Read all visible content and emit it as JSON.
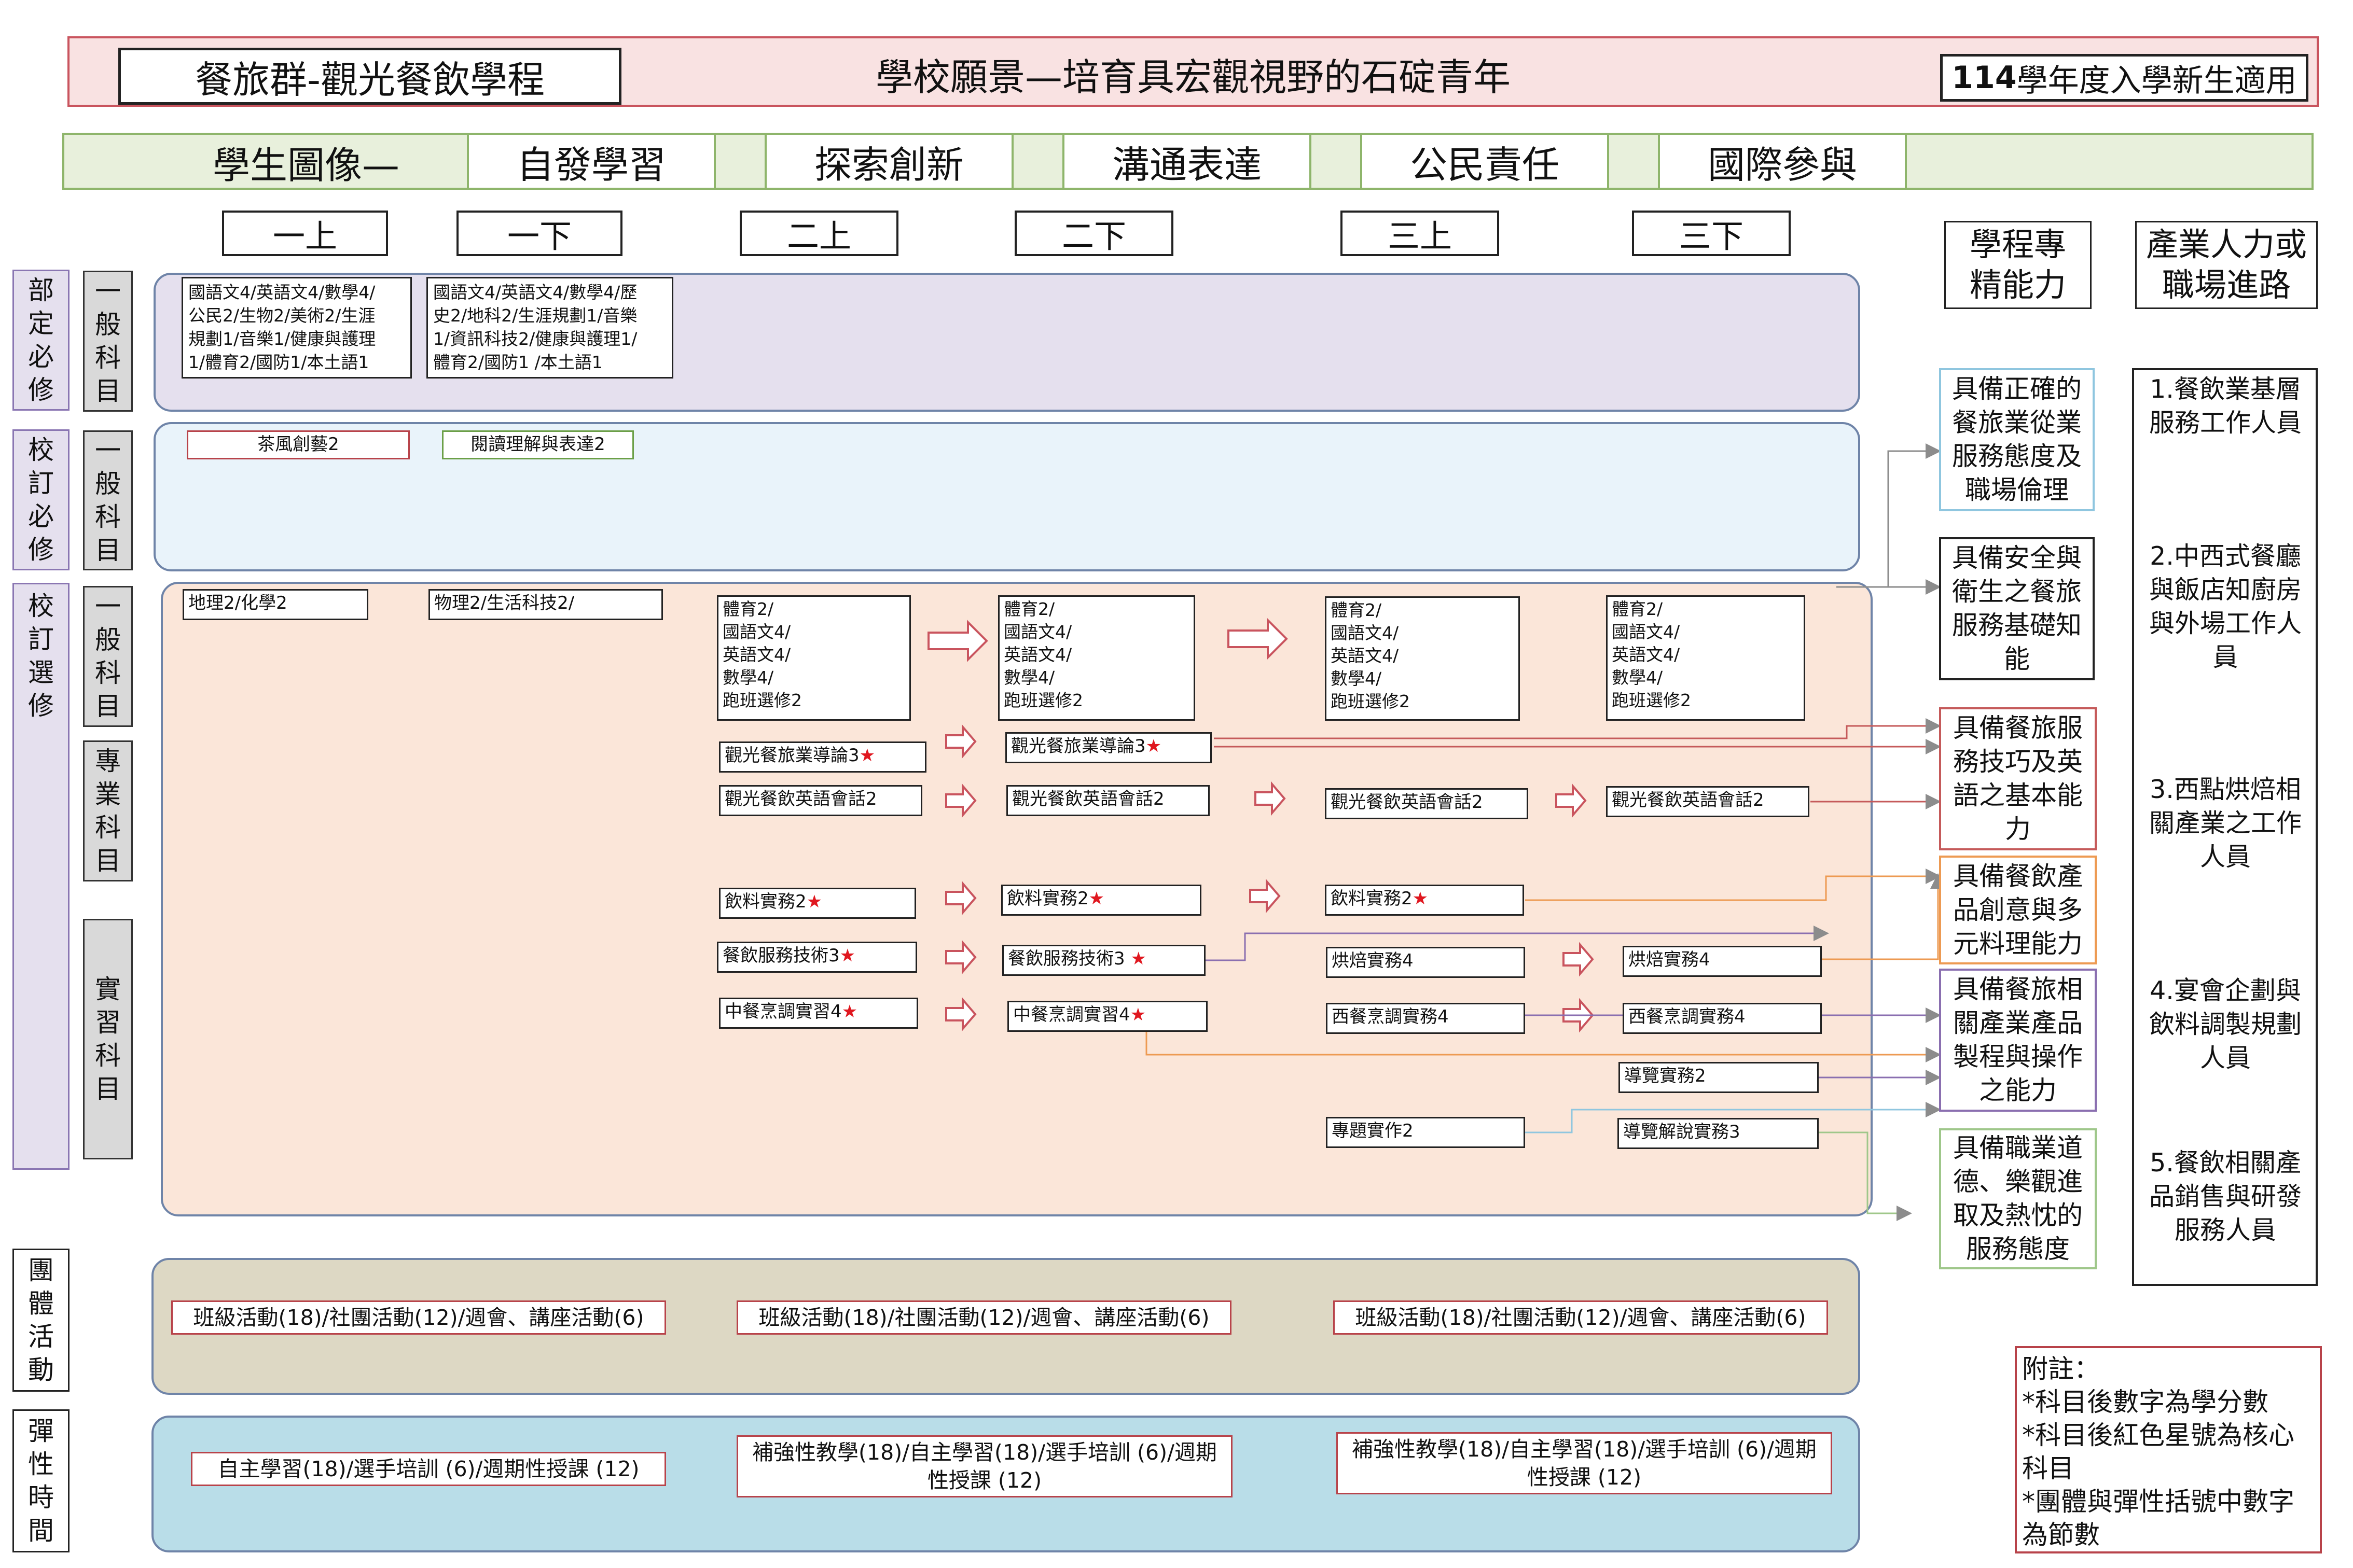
{
  "header": {
    "program": "餐旅群-觀光餐飲學程",
    "vision": "學校願景—培育具宏觀視野的石碇青年",
    "year_num": "114",
    "year_rest": "學年度入學新生適用"
  },
  "portrait": {
    "label": "學生圖像—",
    "items": [
      "自發學習",
      "探索創新",
      "溝通表達",
      "公民責任",
      "國際參與"
    ]
  },
  "semesters": [
    "一上",
    "一下",
    "二上",
    "二下",
    "三上",
    "三下"
  ],
  "right_headers": {
    "abilities": "學程專精能力",
    "careers": "產業人力或職場進路"
  },
  "categories": {
    "required": "部定必修",
    "school_required": "校訂必修",
    "school_elective": "校訂選修",
    "group_activity": "團體活動",
    "flex_time": "彈性時間"
  },
  "subcategories": {
    "general1": "一般科目",
    "general2": "一般科目",
    "general3": "一般科目",
    "professional": "專業科目",
    "practical": "實習科目"
  },
  "required_general": {
    "g10_1": [
      "國語文4/英語文4/數學4/",
      "公民2/生物2/美術2/生涯",
      "規劃1/音樂1/健康與護理",
      "1/體育2/國防1/本土語1"
    ],
    "g10_2": [
      "國語文4/英語文4/數學4/歷",
      "史2/地科2/生涯規劃1/音樂",
      "1/資訊科技2/健康與護理1/",
      "體育2/國防1 /本土語1"
    ]
  },
  "school_required": {
    "tea": "茶風創藝2",
    "reading": "閱讀理解與表達2"
  },
  "elective_general": {
    "g10_1": "地理2/化學2",
    "g10_2": "物理2/生活科技2/",
    "block": [
      "體育2/",
      "國語文4/",
      "英語文4/",
      "數學4/",
      "跑班選修2"
    ]
  },
  "professional": {
    "intro": "觀光餐旅業導論3",
    "english": "觀光餐飲英語會話2"
  },
  "practical": {
    "beverage": "飲料實務2",
    "service": "餐飲服務技術3",
    "chinese": "中餐烹調實習4",
    "baking": "烘焙實務4",
    "western": "西餐烹調實務4",
    "guide": "導覽實務2",
    "project": "專題實作2",
    "guide_commentary": "導覽解說實務3"
  },
  "star": "★",
  "group_activity": "班級活動(18)/社團活動(12)/週會、講座活動(6)",
  "flex": {
    "g10": "自主學習(18)/選手培訓 (6)/週期性授課 (12)",
    "g11_line1": "補強性教學(18)/自主學習(18)/選手培訓 (6)/週期",
    "g11_line2": "性授課 (12)",
    "g12_line1": "補強性教學(18)/自主學習(18)/選手培訓 (6)/週期",
    "g12_line2": "性授課 (12)"
  },
  "abilities": [
    {
      "text": "具備正確的餐旅業從業服務態度及職場倫理",
      "color": "#8fc6df"
    },
    {
      "text": "具備安全與衛生之餐旅服務基礎知能",
      "color": "#222222"
    },
    {
      "text": "具備餐旅服務技巧及英語之基本能力",
      "color": "#c55a5a"
    },
    {
      "text": "具備餐飲產品創意與多元料理能力",
      "color": "#ed9a52"
    },
    {
      "text": "具備餐旅相關產業產品製程與操作之能力",
      "color": "#8a6fb0"
    },
    {
      "text": "具備職業道德、樂觀進取及熱忱的服務態度",
      "color": "#9fc78a"
    }
  ],
  "careers": [
    "1.餐飲業基層服務工作人員",
    "2.中西式餐廳與飯店知廚房與外場工作人員",
    "3.西點烘焙相關產業之工作人員",
    "4.宴會企劃與飲料調製規劃人員",
    "5.餐飲相關產品銷售與研發服務人員"
  ],
  "notes": [
    "附註：",
    "*科目後數字為學分數",
    "*科目後紅色星號為核心科目",
    "*團體與彈性括號中數字為節數"
  ],
  "colors": {
    "header_bg": "#f9e2e2",
    "portrait_bg": "#e8f0dc",
    "required_bg": "#e5e0ee",
    "school_required_bg": "#e9f3fa",
    "elective_bg": "#fbe6d9",
    "group_bg": "#ddd8c4",
    "flex_bg": "#b9dde8",
    "star": "#e0171f"
  }
}
